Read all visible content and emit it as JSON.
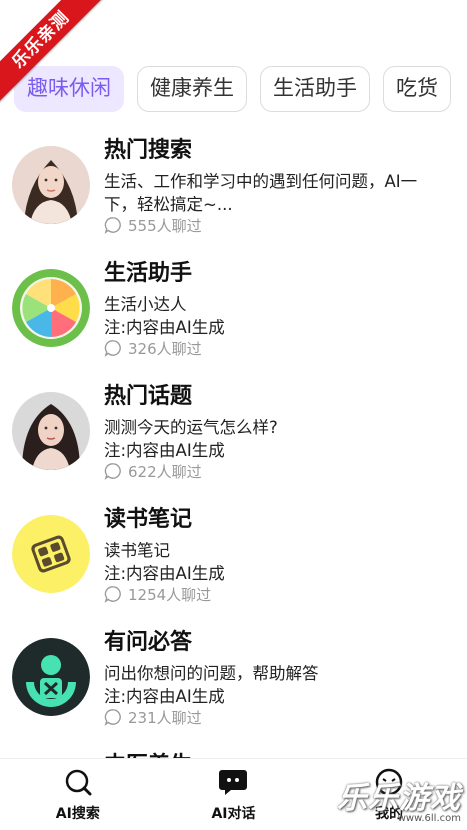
{
  "ribbon": "乐乐亲测",
  "tabs": [
    {
      "label": "趣味休闲",
      "active": true
    },
    {
      "label": "健康养生",
      "active": false
    },
    {
      "label": "生活助手",
      "active": false
    },
    {
      "label": "吃货",
      "active": false
    }
  ],
  "items": [
    {
      "title": "热门搜索",
      "desc": "生活、工作和学习中的遇到任何问题，AI一下，轻松搞定~...",
      "count": "555人聊过"
    },
    {
      "title": "生活助手",
      "desc": "生活小达人\n注:内容由AI生成",
      "count": "326人聊过"
    },
    {
      "title": "热门话题",
      "desc": "测测今天的运气怎么样?\n注:内容由AI生成",
      "count": "622人聊过"
    },
    {
      "title": "读书笔记",
      "desc": "读书笔记\n注:内容由AI生成",
      "count": "1254人聊过"
    },
    {
      "title": "有问必答",
      "desc": "问出你想问的问题，帮助解答\n注:内容由AI生成",
      "count": "231人聊过"
    },
    {
      "title": "中医养生",
      "desc": "",
      "count": ""
    }
  ],
  "nav": {
    "search": "AI搜索",
    "chat": "AI对话",
    "mine": "我的"
  },
  "watermark": {
    "big": "乐乐游戏",
    "small": "www.6ll.com"
  },
  "colors": {
    "accent": "#7b5cf0",
    "tab_active_bg": "#ede7ff",
    "ribbon": "#d8161b"
  }
}
